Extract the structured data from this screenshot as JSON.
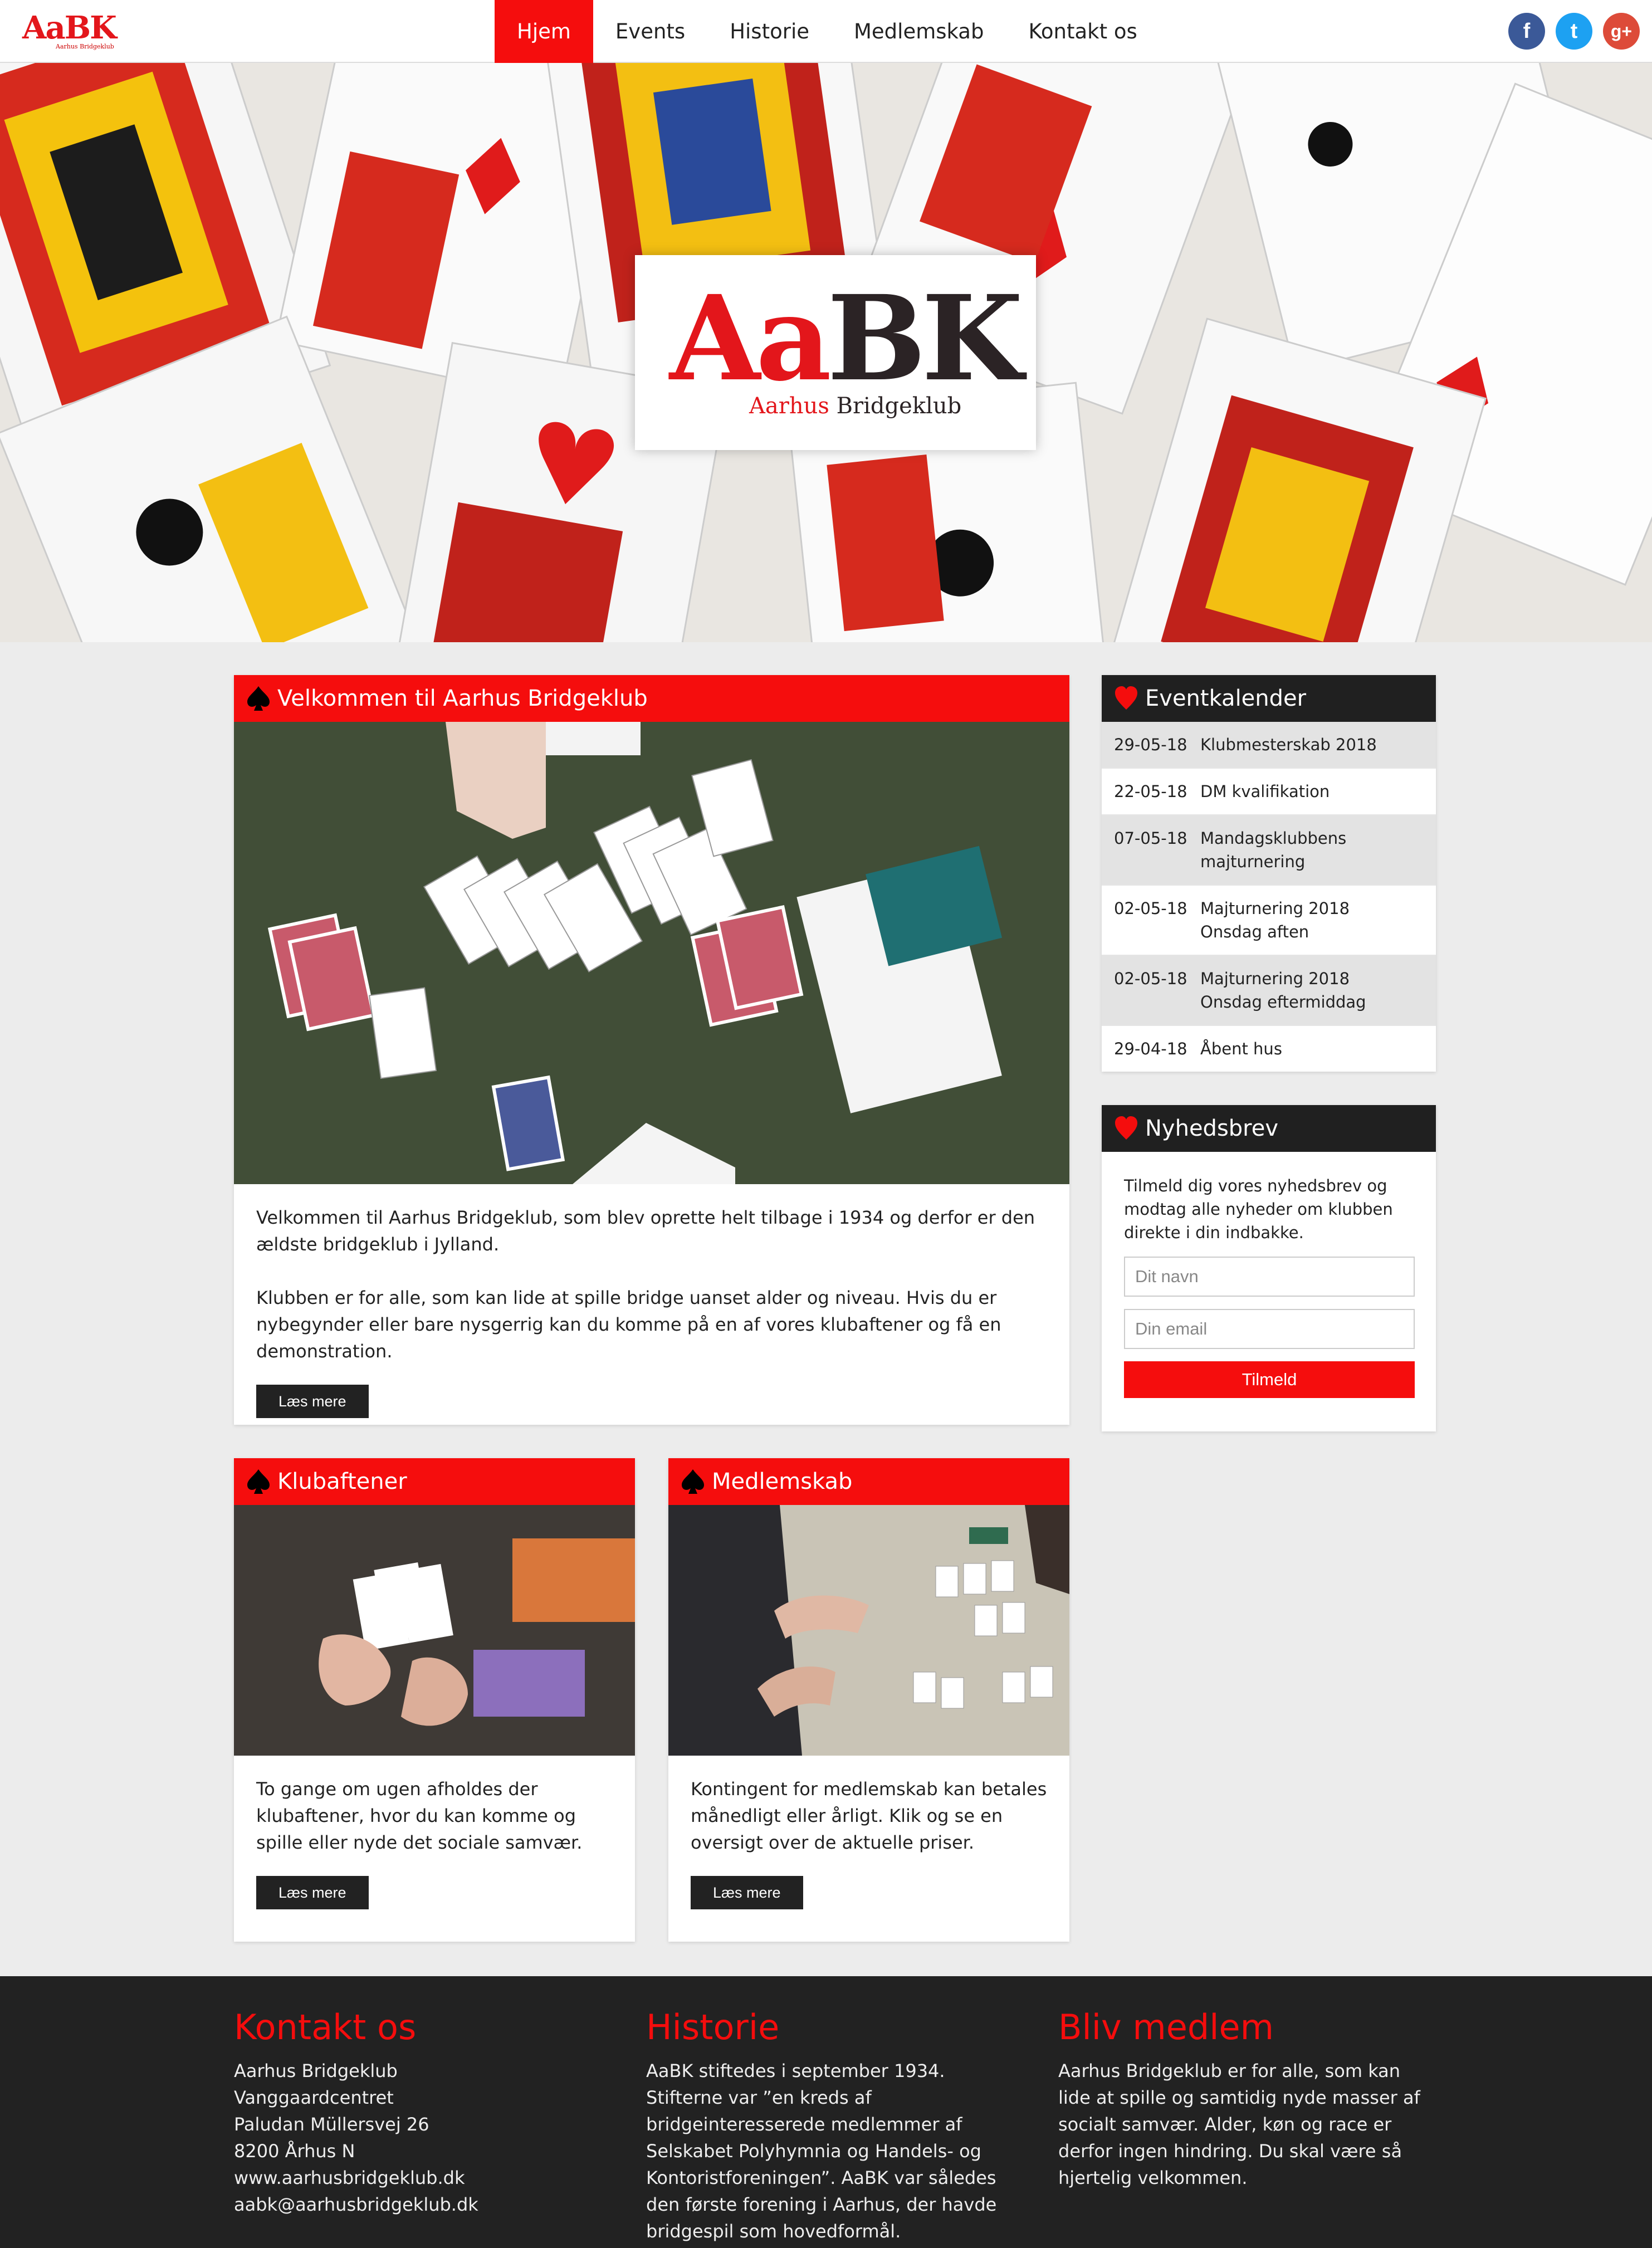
{
  "nav": {
    "logo_text": "AaBK",
    "logo_sub": "Aarhus Bridgeklub",
    "menu": [
      "Hjem",
      "Events",
      "Historie",
      "Medlemskab",
      "Kontakt os"
    ],
    "social": [
      {
        "icon": "facebook-icon",
        "glyph": "f",
        "color": "#3b5998"
      },
      {
        "icon": "twitter-icon",
        "glyph": "t",
        "color": "#1da1f2"
      },
      {
        "icon": "google-plus-icon",
        "glyph": "g+",
        "color": "#dd4b39"
      }
    ]
  },
  "hero": {
    "logo_a": "Aa",
    "logo_b": "BK",
    "logo_sub_a": "Aarhus",
    "logo_sub_b": " Bridgeklub"
  },
  "welcome": {
    "title": "Velkommen til Aarhus Bridgeklub",
    "p1": "Velkommen til Aarhus Bridgeklub, som blev oprette helt tilbage i 1934 og derfor er den ældste bridgeklub i Jylland.",
    "p2": "Klubben er for alle, som kan lide at spille bridge uanset alder og niveau. Hvis du er nybegynder eller bare nysgerrig kan du komme på en af vores klubaftener og få en demonstration.",
    "button": "Læs mere"
  },
  "klubaftener": {
    "title": "Klubaftener",
    "text": "To gange om ugen afholdes der klubaftener, hvor du kan komme og spille eller nyde det sociale samvær.",
    "button": "Læs mere"
  },
  "medlemskab": {
    "title": "Medlemskab",
    "text": "Kontingent for medlemskab kan betales månedligt eller årligt. Klik og se en oversigt over de aktuelle priser.",
    "button": "Læs mere"
  },
  "events": {
    "title": "Eventkalender",
    "items": [
      {
        "date": "29-05-18",
        "name": "Klubmesterskab 2018"
      },
      {
        "date": "22-05-18",
        "name": "DM kvalifikation"
      },
      {
        "date": "07-05-18",
        "name": "Mandagsklubbens majturnering"
      },
      {
        "date": "02-05-18",
        "name": "Majturnering 2018 Onsdag aften"
      },
      {
        "date": "02-05-18",
        "name": "Majturnering 2018 Onsdag eftermiddag"
      },
      {
        "date": "29-04-18",
        "name": "Åbent hus"
      }
    ]
  },
  "newsletter": {
    "title": "Nyhedsbrev",
    "text": "Tilmeld dig vores nyhedsbrev og modtag alle nyheder om klubben direkte i din indbakke.",
    "name_placeholder": "Dit navn",
    "email_placeholder": "Din email",
    "button": "Tilmeld"
  },
  "footer": {
    "contact": {
      "title": "Kontakt os",
      "lines": [
        "Aarhus Bridgeklub",
        "Vanggaardcentret",
        "Paludan Müllersvej 26",
        "8200 Århus N",
        "www.aarhusbridgeklub.dk",
        "aabk@aarhusbridgeklub.dk"
      ]
    },
    "history": {
      "title": "Historie",
      "text": "AaBK stiftedes i september 1934. Stifterne var ”en kreds af bridgeinteresserede medlemmer af Selskabet Polyhymnia og Handels- og Kontoristforeningen”. AaBK var således den første forening i Aarhus, der havde bridgespil som hovedformål."
    },
    "join": {
      "title": "Bliv medlem",
      "text": "Aarhus Bridgeklub er for alle, som kan lide at spille og samtidig nyde masser af socialt samvær. Alder, køn og race er derfor ingen hindring. Du skal være så hjertelig velkommen."
    }
  }
}
